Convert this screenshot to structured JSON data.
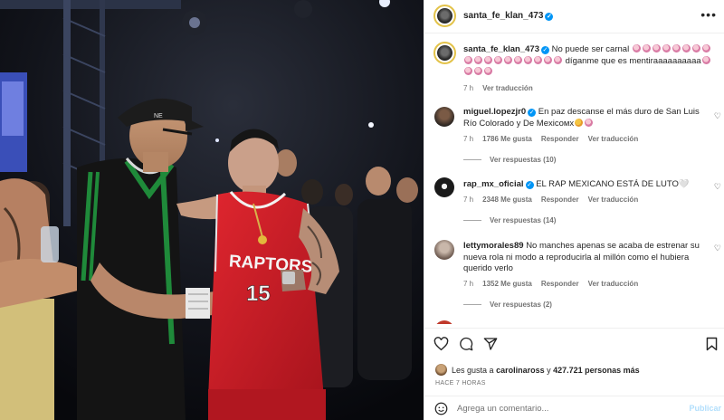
{
  "post": {
    "account": "santa_fe_klan_473",
    "more_icon": "more-horizontal-icon"
  },
  "caption": {
    "user": "santa_fe_klan_473",
    "text_start": "No puede ser carnal",
    "text_end": "díganme que es mentiraaaaaaaaaa",
    "time": "7 h",
    "translate": "Ver traducción"
  },
  "comments": [
    {
      "user": "miguel.lopezjr0",
      "verified": true,
      "text": "En paz descanse el más duro de San Luis Río Colorado y De Mexicoмх",
      "time": "7 h",
      "likes": "1786 Me gusta",
      "reply": "Responder",
      "translate": "Ver traducción",
      "replies": "Ver respuestas (10)"
    },
    {
      "user": "rap_mx_oficial",
      "verified": true,
      "text": "EL RAP MEXICANO ESTÁ DE LUTO🤍",
      "time": "7 h",
      "likes": "2348 Me gusta",
      "reply": "Responder",
      "translate": "Ver traducción",
      "replies": "Ver respuestas (14)"
    },
    {
      "user": "lettymorales89",
      "verified": false,
      "text": "No manches apenas se acaba de estrenar su nueva rola ni modo a reproducirla al millón como el hubiera querido verlo",
      "time": "7 h",
      "likes": "1352 Me gusta",
      "reply": "Responder",
      "translate": "Ver traducción",
      "replies": "Ver respuestas (2)"
    }
  ],
  "likes_bar": {
    "prefix": "Les gusta a",
    "user": "carolinaross",
    "middle": "y",
    "count": "427.721 personas más",
    "time_ago": "HACE 7 HORAS"
  },
  "add_comment": {
    "placeholder": "Agrega un comentario...",
    "post_label": "Publicar"
  },
  "photo": {
    "jersey_brand": "RAPTORS",
    "jersey_number": "15"
  },
  "colors": {
    "accent_blue": "#0095f6",
    "post_disabled": "#b2dffc",
    "jersey_red": "#d41f2a"
  }
}
